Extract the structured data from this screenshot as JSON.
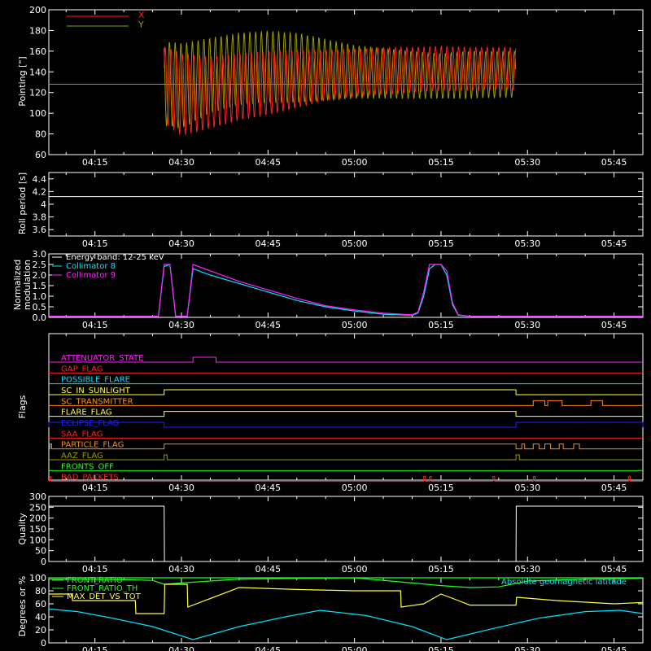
{
  "time_ticks": [
    "04:15",
    "04:30",
    "04:45",
    "05:00",
    "05:15",
    "05:30",
    "05:45"
  ],
  "time_tick_minutes": [
    15,
    30,
    45,
    60,
    75,
    90,
    105
  ],
  "chart_data": [
    {
      "type": "line",
      "ylabel": "Pointing [\"]",
      "ylim": [
        60,
        200
      ],
      "yticks": [
        60,
        80,
        100,
        120,
        140,
        160,
        180,
        200
      ],
      "legend": [
        {
          "name": "X",
          "color": "#ff2020"
        },
        {
          "name": "Y",
          "color": "#9a9a00"
        }
      ],
      "x_range_minutes": [
        7,
        110
      ],
      "series": [
        {
          "name": "X",
          "color": "#ff2020",
          "x": [
            27,
            30,
            35,
            40,
            45,
            50,
            55,
            60,
            65,
            70,
            75,
            80,
            85,
            88
          ],
          "upper": [
            165,
            158,
            155,
            158,
            160,
            161,
            161,
            162,
            164,
            164,
            165,
            164,
            164,
            164
          ],
          "lower": [
            90,
            78,
            85,
            93,
            98,
            105,
            112,
            116,
            118,
            120,
            122,
            122,
            123,
            122
          ]
        },
        {
          "name": "Y",
          "color": "#9a9a00",
          "x": [
            27,
            30,
            35,
            40,
            45,
            50,
            55,
            60,
            65,
            70,
            75,
            80,
            85,
            88
          ],
          "upper": [
            170,
            168,
            173,
            178,
            180,
            178,
            172,
            166,
            163,
            160,
            158,
            160,
            160,
            160
          ],
          "lower": [
            88,
            85,
            100,
            108,
            110,
            110,
            112,
            114,
            114,
            114,
            114,
            114,
            115,
            115
          ],
          "baseline": 128
        }
      ]
    },
    {
      "type": "line",
      "ylabel": "Roll period [s]",
      "ylim": [
        3.5,
        4.5
      ],
      "yticks": [
        3.6,
        3.8,
        4.0,
        4.2,
        4.4
      ],
      "series": [
        {
          "name": "",
          "color": "#ffffff",
          "x": [
            7,
            110
          ],
          "y": [
            4.12,
            4.12
          ]
        }
      ]
    },
    {
      "type": "line",
      "ylabel": "Normalized modulation",
      "ylim": [
        0,
        3
      ],
      "yticks": [
        0.0,
        0.5,
        1.0,
        1.5,
        2.0,
        2.5,
        3.0
      ],
      "legend": [
        {
          "name": "Energy band: 12-25 keV",
          "color": "#ffffff"
        },
        {
          "name": "Collimator 8",
          "color": "#00e5ff"
        },
        {
          "name": "Collimator 9",
          "color": "#ff20ff"
        }
      ],
      "series": [
        {
          "name": "Collimator 8",
          "color": "#00e5ff",
          "x": [
            7,
            26,
            27,
            28,
            29,
            31,
            32,
            35,
            40,
            45,
            50,
            55,
            60,
            65,
            70,
            71,
            72,
            73,
            74,
            75,
            76,
            77,
            78,
            80,
            90,
            100,
            110
          ],
          "y": [
            0.05,
            0.05,
            2.4,
            2.5,
            0.05,
            0.05,
            2.3,
            2.0,
            1.6,
            1.2,
            0.8,
            0.5,
            0.3,
            0.15,
            0.1,
            0.2,
            1.0,
            2.3,
            2.5,
            2.5,
            2.0,
            0.6,
            0.1,
            0.05,
            0.05,
            0.05,
            0.05
          ]
        },
        {
          "name": "Collimator 9",
          "color": "#ff20ff",
          "x": [
            7,
            26,
            27,
            28,
            29,
            31,
            32,
            35,
            40,
            45,
            50,
            55,
            60,
            65,
            70,
            71,
            72,
            73,
            74,
            75,
            76,
            77,
            78,
            80,
            90,
            100,
            110
          ],
          "y": [
            0.05,
            0.05,
            2.5,
            2.5,
            0.05,
            0.05,
            2.5,
            2.2,
            1.7,
            1.3,
            0.9,
            0.55,
            0.35,
            0.2,
            0.12,
            0.25,
            1.2,
            2.5,
            2.5,
            2.5,
            2.2,
            0.7,
            0.12,
            0.05,
            0.05,
            0.05,
            0.05
          ]
        }
      ]
    },
    {
      "type": "line",
      "ylabel": "Flags",
      "flags": [
        {
          "name": "ATTENUATOR_STATE",
          "color": "#ff20ff",
          "on": [
            [
              32,
              36
            ]
          ]
        },
        {
          "name": "GAP_FLAG",
          "color": "#ff2020",
          "on": []
        },
        {
          "name": "POSSIBLE_FLARE",
          "color": "#00e5ff",
          "on": []
        },
        {
          "name": "SC_IN_SUNLIGHT",
          "color": "#ffff40",
          "on": [
            [
              27,
              88
            ]
          ]
        },
        {
          "name": "SC_TRANSMITTER",
          "color": "#ff8c1a",
          "on": [
            [
              91,
              93
            ],
            [
              93.5,
              96
            ],
            [
              101,
              103
            ]
          ]
        },
        {
          "name": "FLARE_FLAG",
          "color": "#ffff40",
          "on": [
            [
              27,
              88
            ]
          ]
        },
        {
          "name": "ECLIPSE_FLAG",
          "color": "#2020ff",
          "on": [
            [
              7,
              27
            ],
            [
              88,
              110
            ]
          ]
        },
        {
          "name": "SAA_FLAG",
          "color": "#ff2020",
          "on": []
        },
        {
          "name": "PARTICLE_FLAG",
          "color": "#ff8c1a",
          "on": [
            [
              7.2,
              7.5
            ],
            [
              27,
              88
            ],
            [
              89,
              89.5
            ],
            [
              91,
              92
            ],
            [
              93,
              94
            ],
            [
              95.5,
              96.2
            ],
            [
              98,
              99
            ]
          ]
        },
        {
          "name": "AAZ_FLAG",
          "color": "#9a9a00",
          "on": [
            [
              27,
              27.5
            ],
            [
              88,
              88.6
            ]
          ]
        },
        {
          "name": "FRONTS_OFF",
          "color": "#20ff20",
          "on": []
        },
        {
          "name": "BAD_PACKETS",
          "color": "#ff2020",
          "on": [
            [
              7.1,
              7.4
            ],
            [
              72,
              72.3
            ],
            [
              73,
              73.3
            ],
            [
              84,
              84.3
            ],
            [
              91,
              91.3
            ],
            [
              107.5,
              107.8
            ]
          ]
        }
      ]
    },
    {
      "type": "line",
      "ylabel": "Quality",
      "ylim": [
        0,
        300
      ],
      "yticks": [
        0,
        50,
        100,
        150,
        200,
        250,
        300
      ],
      "series": [
        {
          "name": "",
          "color": "#ffffff",
          "x": [
            7,
            27,
            27.05,
            88,
            88.05,
            110
          ],
          "y": [
            255,
            255,
            0,
            0,
            255,
            255
          ]
        }
      ]
    },
    {
      "type": "line",
      "ylabel": "Degrees or %",
      "ylim": [
        0,
        100
      ],
      "yticks": [
        0,
        20,
        40,
        60,
        80,
        100
      ],
      "legend": [
        {
          "name": "FRONT_RATIO",
          "color": "#20ff20"
        },
        {
          "name": "FRONT_RATIO_TH",
          "color": "#20ff20"
        },
        {
          "name": "MAX_DET_VS_TOT",
          "color": "#ffff40"
        },
        {
          "name": "Absolute geomagnetic latitude",
          "color": "#00e5ff"
        }
      ],
      "series": [
        {
          "name": "FRONT_RATIO",
          "color": "#20ff20",
          "x": [
            7,
            20,
            25,
            27,
            30,
            35,
            40,
            50,
            60,
            70,
            75,
            80,
            85,
            90,
            100,
            110
          ],
          "y": [
            98,
            97,
            96,
            90,
            92,
            95,
            98,
            99,
            100,
            92,
            88,
            85,
            86,
            95,
            98,
            99
          ]
        },
        {
          "name": "FRONT_RATIO_TH",
          "color": "#20ff20",
          "x": [
            7,
            110
          ],
          "y": [
            100,
            100
          ]
        },
        {
          "name": "MAX_DET_VS_TOT",
          "color": "#ffff40",
          "x": [
            7,
            11,
            11.1,
            22,
            22.1,
            27,
            27.1,
            31,
            31.1,
            40,
            50,
            60,
            68,
            68.1,
            72,
            75,
            78,
            80,
            80.1,
            88,
            88.1,
            95,
            105,
            110
          ],
          "y": [
            75,
            75,
            65,
            65,
            45,
            45,
            90,
            90,
            55,
            85,
            82,
            80,
            80,
            55,
            60,
            75,
            65,
            58,
            58,
            58,
            70,
            65,
            60,
            62
          ]
        },
        {
          "name": "Absolute geomagnetic latitude",
          "color": "#00e5ff",
          "x": [
            7,
            12,
            18,
            25,
            32,
            40,
            48,
            54,
            62,
            70,
            76,
            84,
            92,
            100,
            106,
            110
          ],
          "y": [
            52,
            48,
            38,
            25,
            5,
            25,
            40,
            50,
            42,
            25,
            5,
            22,
            38,
            48,
            50,
            45
          ]
        }
      ]
    }
  ]
}
